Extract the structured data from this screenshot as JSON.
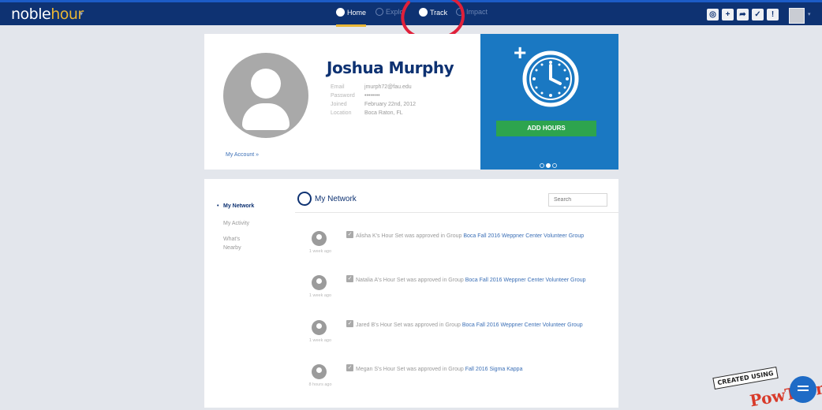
{
  "topbar": {
    "logo_text": "noble",
    "logo_accent": "hour",
    "nav": [
      {
        "label": "Home",
        "active": true
      },
      {
        "label": "Explo",
        "active": false
      },
      {
        "label": "Track",
        "active": false
      },
      {
        "label": "Impact",
        "active": false
      }
    ],
    "tool_icons": [
      "chat-icon",
      "plus-icon",
      "share-icon",
      "check-icon",
      "alert-icon"
    ],
    "brand_color": "#0e3272",
    "accent_color": "#e9b635"
  },
  "profile": {
    "name": "Joshua Murphy",
    "fields": [
      {
        "label": "Email",
        "value": "jmurph72@fau.edu"
      },
      {
        "label": "Password",
        "value": "••••••••"
      },
      {
        "label": "Joined",
        "value": "February 22nd, 2012"
      },
      {
        "label": "Location",
        "value": "Boca Raton, FL"
      }
    ],
    "account_link": "My Account »"
  },
  "promo": {
    "button_label": "ADD HOURS",
    "button_color": "#2da44e",
    "background": "#1a78c2"
  },
  "network": {
    "sidebar": [
      {
        "label": "My Network",
        "active": true
      },
      {
        "label": "My Activity",
        "active": false
      },
      {
        "label": "What's Nearby",
        "active": false
      }
    ],
    "title": "My Network",
    "search_placeholder": "Search",
    "feed": [
      {
        "text": "Alisha K's Hour Set was approved in Group",
        "group": "Boca Fall 2016 Weppner Center Volunteer Group",
        "time": "1 week ago"
      },
      {
        "text": "Natalia A's Hour Set was approved in Group",
        "group": "Boca Fall 2016 Weppner Center Volunteer Group",
        "time": "1 week ago"
      },
      {
        "text": "Jared B's Hour Set was approved in Group",
        "group": "Boca Fall 2016 Weppner Center Volunteer Group",
        "time": "1 week ago"
      },
      {
        "text": "Megan S's Hour Set was approved in Group",
        "group": "Fall 2016 Sigma Kappa",
        "time": "8 hours ago"
      }
    ]
  },
  "watermark": {
    "label": "CREATED USING",
    "logo": "PowToon"
  }
}
